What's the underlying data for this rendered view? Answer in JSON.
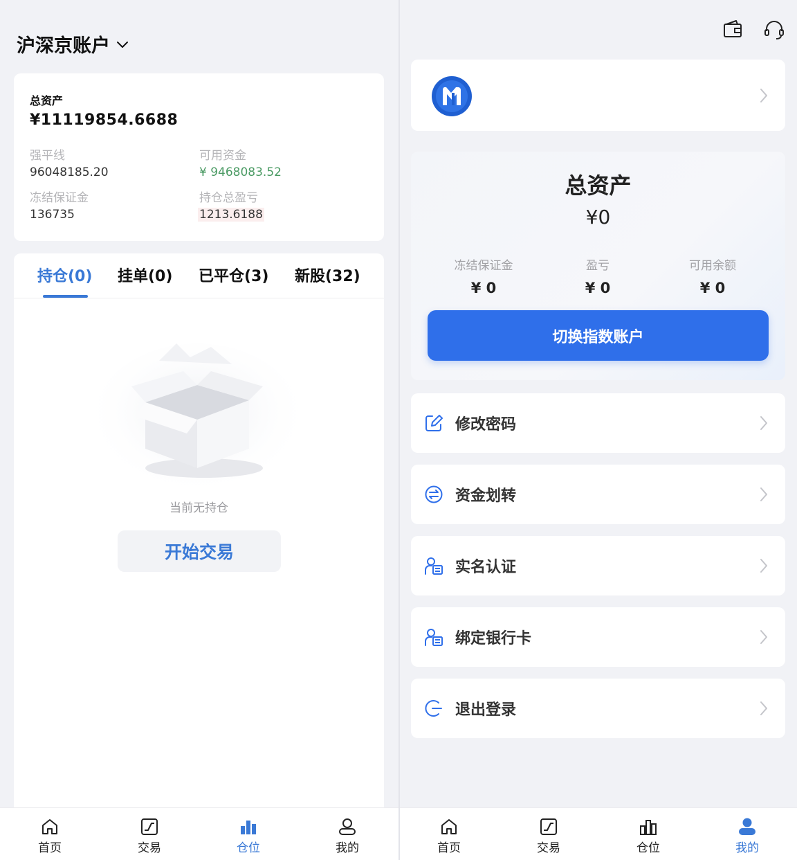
{
  "left": {
    "account_title": "沪深京账户",
    "total_assets_label": "总资产",
    "total_assets_value": "¥11119854.6688",
    "stats": {
      "liquidation_line_label": "强平线",
      "liquidation_line_value": "96048185.20",
      "available_funds_label": "可用资金",
      "available_funds_value": "¥ 9468083.52",
      "frozen_margin_label": "冻结保证金",
      "frozen_margin_value": "136735",
      "position_pnl_label": "持仓总盈亏",
      "position_pnl_value": "1213.6188"
    },
    "tabs": [
      {
        "label": "持仓(0)",
        "active": true
      },
      {
        "label": "挂单(0)",
        "active": false
      },
      {
        "label": "已平仓(3)",
        "active": false
      },
      {
        "label": "新股(32)",
        "active": false
      }
    ],
    "empty_text": "当前无持仓",
    "start_trading_label": "开始交易",
    "nav": [
      {
        "label": "首页",
        "icon": "home-icon"
      },
      {
        "label": "交易",
        "icon": "trade-icon"
      },
      {
        "label": "仓位",
        "icon": "position-icon",
        "active": true
      },
      {
        "label": "我的",
        "icon": "user-icon"
      }
    ]
  },
  "right": {
    "summary": {
      "title": "总资产",
      "value": "¥0",
      "frozen_margin_label": "冻结保证金",
      "frozen_margin_value": "¥ 0",
      "pnl_label": "盈亏",
      "pnl_value": "¥ 0",
      "available_balance_label": "可用余额",
      "available_balance_value": "¥ 0"
    },
    "switch_button_label": "切换指数账户",
    "menu": [
      {
        "label": "修改密码",
        "icon": "edit-icon"
      },
      {
        "label": "资金划转",
        "icon": "transfer-icon"
      },
      {
        "label": "实名认证",
        "icon": "id-card-icon"
      },
      {
        "label": "绑定银行卡",
        "icon": "id-card-icon"
      },
      {
        "label": "退出登录",
        "icon": "logout-icon"
      }
    ],
    "nav": [
      {
        "label": "首页",
        "icon": "home-icon"
      },
      {
        "label": "交易",
        "icon": "trade-icon"
      },
      {
        "label": "仓位",
        "icon": "position-icon"
      },
      {
        "label": "我的",
        "icon": "user-icon",
        "active": true
      }
    ]
  },
  "colors": {
    "accent": "#3a79d6",
    "button_blue": "#2f6fea",
    "positive_green": "#4a9a63",
    "background": "#f1f2f6"
  }
}
